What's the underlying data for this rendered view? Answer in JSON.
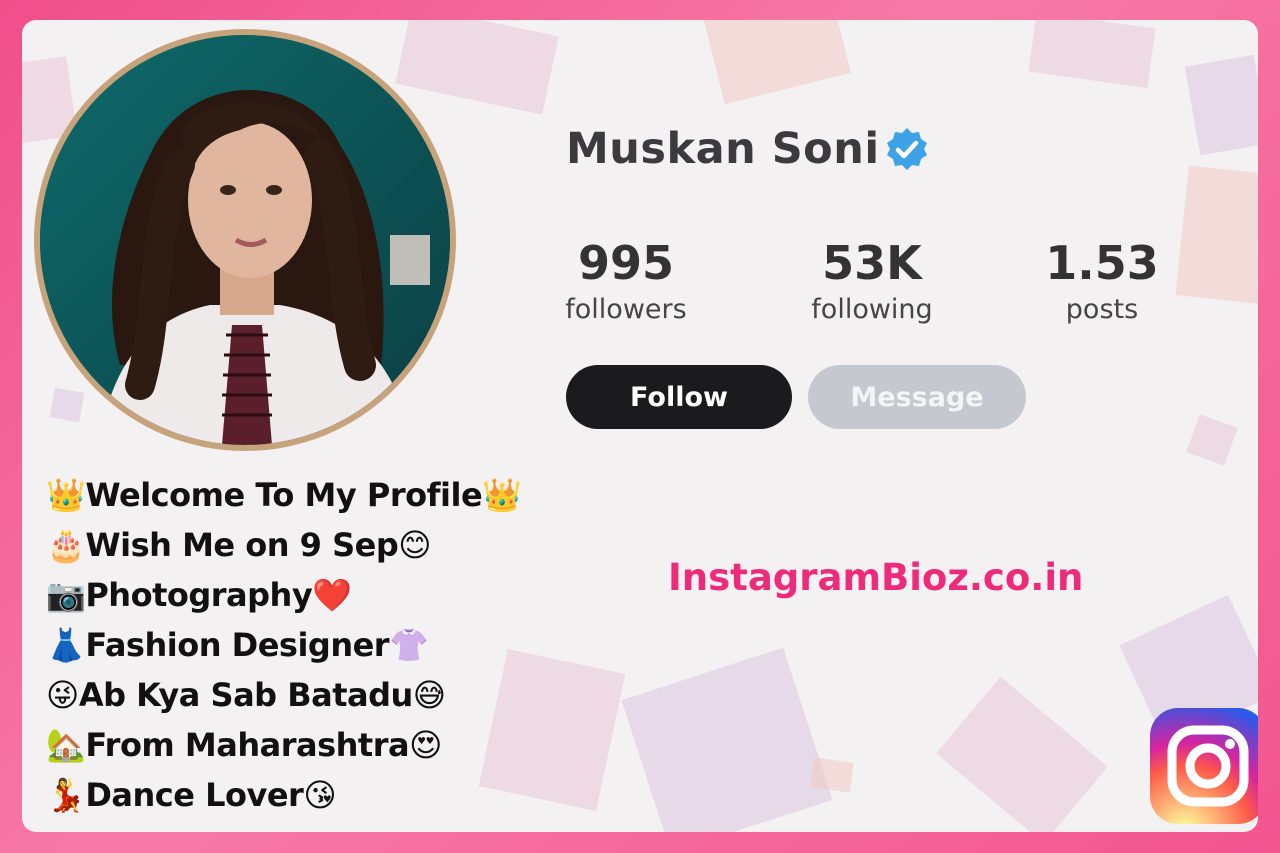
{
  "profile": {
    "name": "Muskan Soni",
    "avatar_alt": "profile-photo"
  },
  "stats": [
    {
      "value": "995",
      "label": "followers"
    },
    {
      "value": "53K",
      "label": "following"
    },
    {
      "value": "1.53",
      "label": "posts"
    }
  ],
  "buttons": {
    "follow": "Follow",
    "message": "Message"
  },
  "bio": [
    {
      "lead": "👑",
      "text": "Welcome To My Profile",
      "trail": "👑"
    },
    {
      "lead": "🎂",
      "text": "Wish Me on 9 Sep",
      "trail": "😊"
    },
    {
      "lead": "📷",
      "text": "Photography",
      "trail": "❤️"
    },
    {
      "lead": "👗",
      "text": "Fashion Designer",
      "trail": "👚"
    },
    {
      "lead": "😜",
      "text": "Ab Kya Sab Batadu",
      "trail": "😅"
    },
    {
      "lead": "🏡",
      "text": "From Maharashtra ",
      "trail": "😍"
    },
    {
      "lead": "💃",
      "text": "Dance Lover",
      "trail": "😘"
    }
  ],
  "watermark": "InstagramBioz.co.in",
  "colors": {
    "frame": "#f25a8e",
    "card": "#f4f1f3",
    "follow_button": "#1b1b1d",
    "message_button": "#c5c8cf",
    "verified": "#3ba3e6",
    "watermark": "#ee2a7b"
  },
  "icons": {
    "verified": "verified-badge-icon",
    "instagram": "instagram-logo-icon"
  }
}
